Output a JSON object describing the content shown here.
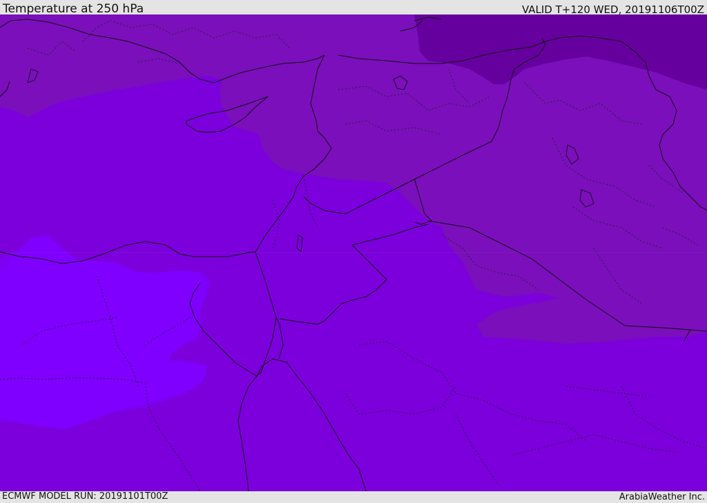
{
  "header": {
    "title": "Temperature at 250 hPa",
    "valid": "VALID T+120 WED, 20191106T00Z"
  },
  "footer": {
    "model_run": "ECMWF MODEL RUN: 20191101T00Z",
    "credit": "ArabiaWeather Inc."
  },
  "colors": {
    "coldest_band": "#65009e",
    "cold_band": "#7a0fbb",
    "mid_band": "#7b00dc",
    "warm_band": "#7d00f4",
    "warmest_band": "#7f00ff",
    "border_line": "#111111"
  }
}
